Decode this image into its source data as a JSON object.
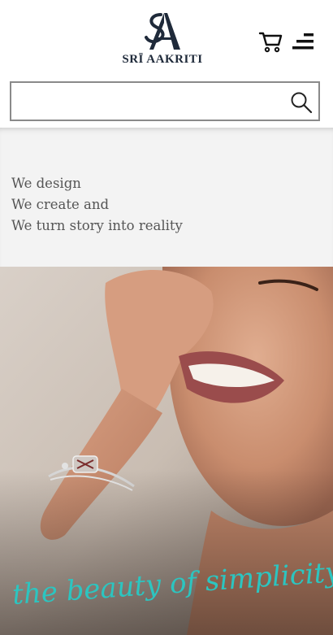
{
  "brand": {
    "name": "SRĪ AAKRITI",
    "monogram": "SA"
  },
  "header": {
    "cart_icon": "cart-icon",
    "menu_icon": "hamburger-menu-icon"
  },
  "search": {
    "value": "",
    "placeholder": "",
    "icon": "search-icon"
  },
  "tagline": {
    "lines": [
      "We design",
      "We create and",
      "We turn story into reality"
    ]
  },
  "hero": {
    "caption": "the beauty of simplicity",
    "caption_color": "#2cc5c0"
  },
  "colors": {
    "brand_dark": "#1f2a3a",
    "tagline_bg": "#f3f3f3",
    "tagline_text": "#555555",
    "search_border": "#8a8a8a"
  }
}
